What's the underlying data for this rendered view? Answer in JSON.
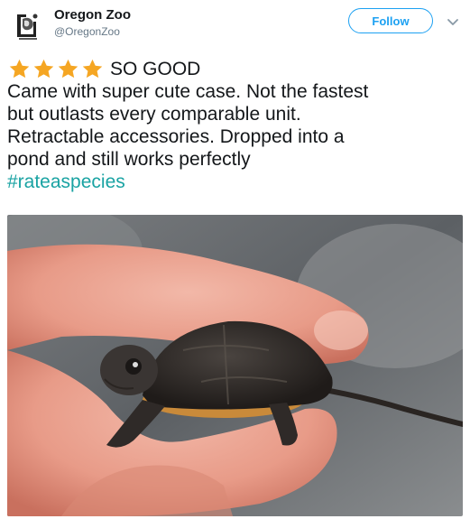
{
  "header": {
    "display_name": "Oregon Zoo",
    "handle": "@OregonZoo",
    "follow_label": "Follow"
  },
  "tweet": {
    "rating_stars": 4,
    "rating_headline": "SO GOOD",
    "lines": [
      "Came with super cute case. Not the fastest",
      "but outlasts every comparable unit.",
      "Retractable accessories. Dropped into a",
      "pond and still works perfectly"
    ],
    "hashtag": "#rateaspecies"
  },
  "colors": {
    "accent": "#1da1f2",
    "star": "#f5a623",
    "hashtag": "#1aa3a3"
  },
  "icons": {
    "star": "star-icon",
    "caret": "chevron-down-icon",
    "logo": "oregon-zoo-logo-icon"
  }
}
